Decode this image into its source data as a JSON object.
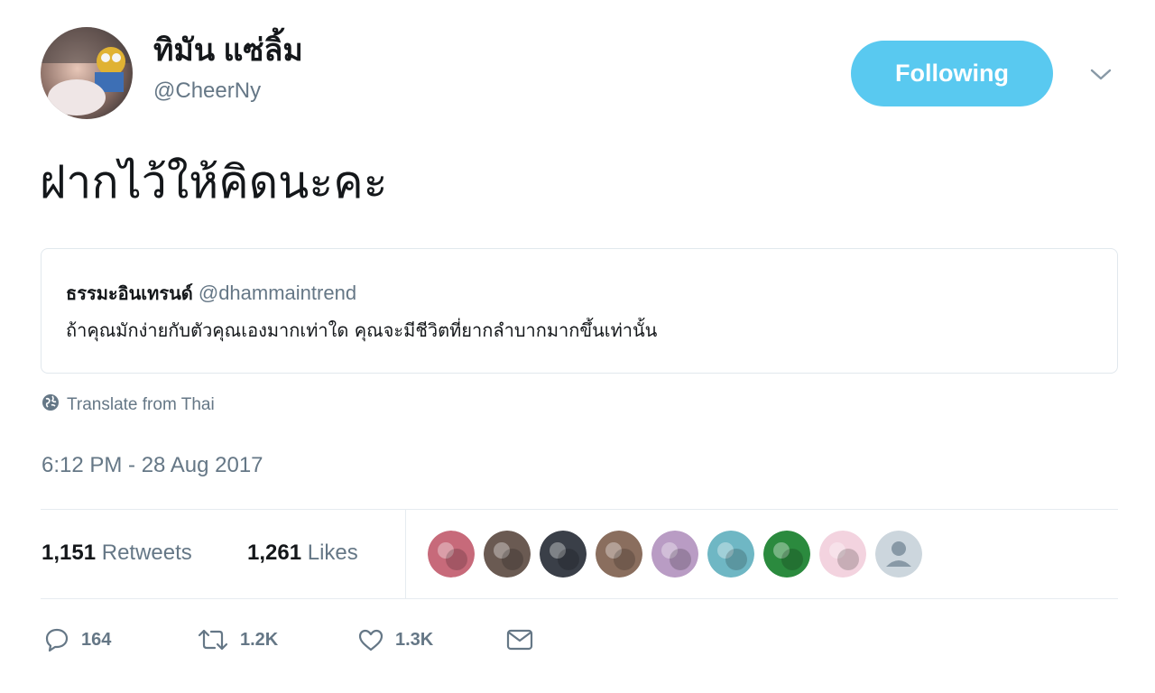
{
  "author": {
    "display_name": "ทิมัน แซ่ลิ้ม",
    "handle": "@CheerNy",
    "avatar_icon": "user-avatar"
  },
  "follow_button": {
    "label": "Following",
    "color": "#59c9f0"
  },
  "menu_icon": "chevron-down-icon",
  "tweet": {
    "text": "ฝากไว้ให้คิดนะคะ"
  },
  "quoted_tweet": {
    "author_name": "ธรรมะอินเทรนด์",
    "author_handle": "@dhammaintrend",
    "text": "ถ้าคุณมักง่ายกับตัวคุณเองมากเท่าใด คุณจะมีชีวิตที่ยากลำบากมากขึ้นเท่านั้น"
  },
  "translate": {
    "label": "Translate from Thai",
    "icon": "globe-icon"
  },
  "timestamp": "6:12 PM - 28 Aug 2017",
  "stats": {
    "retweets_count": "1,151",
    "retweets_label": "Retweets",
    "likes_count": "1,261",
    "likes_label": "Likes"
  },
  "likers": [
    {
      "name": "liker-avatar-1",
      "color": "#c76a7a"
    },
    {
      "name": "liker-avatar-2",
      "color": "#6a5a52"
    },
    {
      "name": "liker-avatar-3",
      "color": "#3a3f48"
    },
    {
      "name": "liker-avatar-4",
      "color": "#8a6e5e"
    },
    {
      "name": "liker-avatar-5",
      "color": "#b99cc4"
    },
    {
      "name": "liker-avatar-6",
      "color": "#6fb7c4"
    },
    {
      "name": "liker-avatar-7",
      "color": "#2b8a3e"
    },
    {
      "name": "liker-avatar-8",
      "color": "#f3d3df"
    },
    {
      "name": "liker-avatar-9",
      "color": "#ccd6dd"
    }
  ],
  "actions": {
    "reply_count": "164",
    "retweet_count": "1.2K",
    "like_count": "1.3K"
  },
  "colors": {
    "muted": "#657786",
    "border": "#e1e8ed",
    "text": "#14171a"
  }
}
